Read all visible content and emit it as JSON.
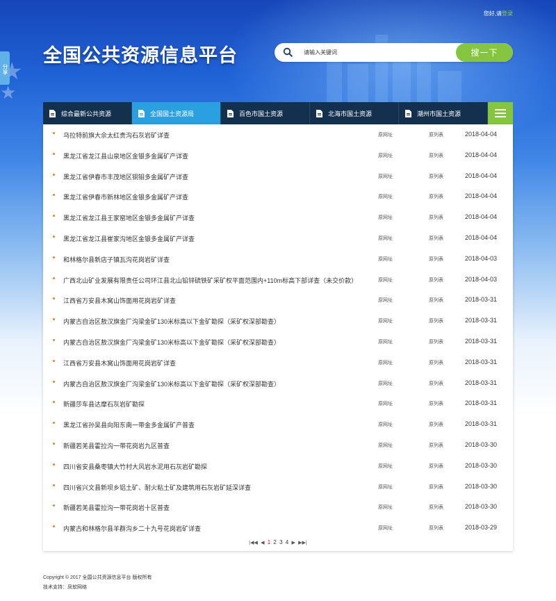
{
  "header": {
    "greeting": "您好,请",
    "login_label": "登录",
    "share_label": "分享",
    "site_title": "全国公共资源信息平台"
  },
  "search": {
    "placeholder": "请输入关键词",
    "button_label": "搜一下"
  },
  "nav": {
    "tabs": [
      {
        "label": "综合最新公共资源",
        "active": false
      },
      {
        "label": "全国国土资源局",
        "active": true
      },
      {
        "label": "百色市国土资源",
        "active": false
      },
      {
        "label": "北海市国土资源",
        "active": false
      },
      {
        "label": "潮州市国土资源",
        "active": false
      }
    ]
  },
  "list": {
    "source_label": "原网址",
    "table_label": "原列表",
    "items": [
      {
        "title": "乌拉特前旗大佘太红贵沟石灰岩矿详查",
        "date": "2018-04-04"
      },
      {
        "title": "黑龙江省龙江县山泉地区金银多金属矿产详查",
        "date": "2018-04-04"
      },
      {
        "title": "黑龙江省伊春市丰茂地区铜钼多金属矿产详查",
        "date": "2018-04-04"
      },
      {
        "title": "黑龙江省伊春市新林地区金银多金属矿产详查",
        "date": "2018-04-04"
      },
      {
        "title": "黑龙江省龙江县王家窑地区金银多金属矿产详查",
        "date": "2018-04-04"
      },
      {
        "title": "黑龙江省龙江县崔家沟地区金银多金属矿产详查",
        "date": "2018-04-04"
      },
      {
        "title": "和林格尔县新店子镇瓦沟花岗岩矿详查",
        "date": "2018-04-03"
      },
      {
        "title": "广西北山矿业发展有限责任公司环江县北山铅锌硫铁矿采矿权平面范围内+110m标高下部详查（未交价款）",
        "date": "2018-04-03"
      },
      {
        "title": "江西省万安县木窝山饰面用花岗岩矿详查",
        "date": "2018-03-31"
      },
      {
        "title": "内蒙古自治区敖汉旗金厂沟梁金矿130米标高以下金矿勘探（采矿权深部勘查）",
        "date": "2018-03-31"
      },
      {
        "title": "内蒙古自治区敖汉旗金厂沟梁金矿130米标高以下金矿勘探（采矿权深部勘查）",
        "date": "2018-03-31"
      },
      {
        "title": "江西省万安县木窝山饰面用花岗岩矿详查",
        "date": "2018-03-31"
      },
      {
        "title": "内蒙古自治区敖汉旗金厂沟梁金矿130米标高以下金矿勘探（采矿权深部勘查）",
        "date": "2018-03-31"
      },
      {
        "title": "新疆莎车县达摩石灰岩矿勘探",
        "date": "2018-03-31"
      },
      {
        "title": "黑龙江省孙吴县向阳东南一带金多金属矿产普查",
        "date": "2018-03-31"
      },
      {
        "title": "新疆若羌县霍拉沟一带花岗岩九区普查",
        "date": "2018-03-30"
      },
      {
        "title": "四川省安县桑枣镇大竹村大风岩水泥用石灰岩矿勘探",
        "date": "2018-03-30"
      },
      {
        "title": "四川省兴文县新坝乡铝土矿、耐火粘土矿及建筑用石灰岩矿延深详查",
        "date": "2018-03-30"
      },
      {
        "title": "新疆若羌县霍拉沟一带花岗岩十区普查",
        "date": "2018-03-30"
      },
      {
        "title": "内蒙古和林格尔县羊群沟乡二十九号花岗岩矿详查",
        "date": "2018-03-29"
      }
    ]
  },
  "pager": {
    "first": "|◀◀",
    "prev": "◀",
    "pages": [
      "1",
      "2",
      "3",
      "4"
    ],
    "current_page": "1",
    "next": "▶",
    "last": "▶▶|"
  },
  "footer": {
    "copyright": "Copyright © 2017 全国公共资源信息平台 版权所有",
    "support": "技术支持：凤软网络"
  },
  "colors": {
    "accent_green": "#86c540",
    "active_tab_blue": "#2aa0e0",
    "nav_dark": "#13304f",
    "bullet_orange": "#f07d1f",
    "current_page_red": "#d01e1e"
  }
}
